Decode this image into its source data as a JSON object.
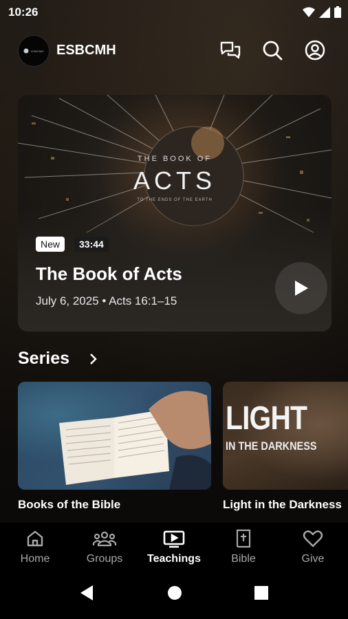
{
  "status_bar": {
    "time": "10:26"
  },
  "header": {
    "brand": "ESBCMH",
    "logo_text": "ESBCMH"
  },
  "hero": {
    "badge_new": "New",
    "duration": "33:44",
    "title": "The Book of Acts",
    "meta": "July 6, 2025 • Acts 16:1–15",
    "banner_sub": "THE BOOK OF",
    "banner_main": "ACTS",
    "banner_small": "TO THE ENDS OF THE EARTH"
  },
  "series": {
    "title": "Series",
    "items": [
      {
        "label": "Books of the Bible"
      },
      {
        "label": "Light in the Darkness",
        "art_title": "LIGHT",
        "art_subtitle": "IN THE DARKNESS"
      }
    ]
  },
  "bottom_nav": {
    "items": [
      {
        "label": "Home",
        "icon": "home-icon"
      },
      {
        "label": "Groups",
        "icon": "groups-icon"
      },
      {
        "label": "Teachings",
        "icon": "teachings-icon",
        "active": true
      },
      {
        "label": "Bible",
        "icon": "bible-icon"
      },
      {
        "label": "Give",
        "icon": "heart-icon"
      }
    ]
  }
}
